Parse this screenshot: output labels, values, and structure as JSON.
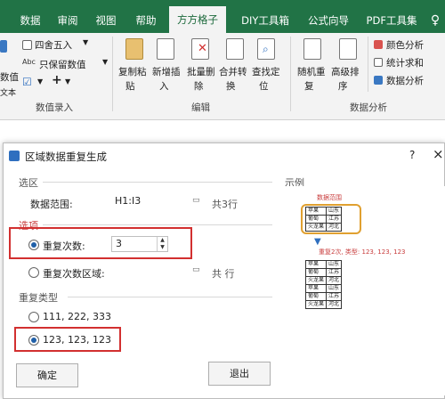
{
  "ribbon": {
    "tabs": [
      "数据",
      "审阅",
      "视图",
      "帮助",
      "方方格子",
      "DIY工具箱",
      "公式向导",
      "PDF工具集"
    ],
    "active_tab": "方方格子",
    "left_items": [
      "四舍五入",
      "只保留数值",
      "数值",
      "文本"
    ],
    "group1_label": "数值录入",
    "edit_buttons": [
      {
        "top": "复制粘",
        "bottom": "贴"
      },
      {
        "top": "新增插",
        "bottom": "入"
      },
      {
        "top": "批量删",
        "bottom": "除"
      },
      {
        "top": "合并转",
        "bottom": "换"
      },
      {
        "top": "查找定",
        "bottom": "位"
      }
    ],
    "group2_label": "编辑",
    "analysis_buttons": [
      {
        "top": "随机重",
        "bottom": "复"
      },
      {
        "top": "高级排",
        "bottom": "序"
      }
    ],
    "right_items": [
      "颜色分析",
      "统计求和",
      "数据分析"
    ],
    "group3_label": "数据分析"
  },
  "dialog": {
    "title": "区域数据重复生成",
    "help": "?",
    "close": "×",
    "section_select": "选区",
    "range_label": "数据范围:",
    "range_value": "H1:I3",
    "range_count": "共3行",
    "section_options": "选项",
    "repeat_count_label": "重复次数:",
    "repeat_count_value": "3",
    "repeat_range_label": "重复次数区域:",
    "repeat_range_count": "共 行",
    "section_type": "重复类型",
    "type_option_1": "111, 222, 333",
    "type_option_2": "123, 123, 123",
    "ok": "确定",
    "exit": "退出",
    "example_label": "示例",
    "example_caption": "数据范围",
    "example_note": "重复2次, 类型: 123, 123, 123",
    "example_source": [
      [
        "苹果",
        "山东"
      ],
      [
        "葡萄",
        "江苏"
      ],
      [
        "火龙果",
        "河北"
      ]
    ],
    "example_result": [
      [
        "苹果",
        "山东"
      ],
      [
        "葡萄",
        "江苏"
      ],
      [
        "火龙果",
        "河北"
      ],
      [
        "苹果",
        "山东"
      ],
      [
        "葡萄",
        "江苏"
      ],
      [
        "火龙果",
        "河北"
      ]
    ]
  }
}
